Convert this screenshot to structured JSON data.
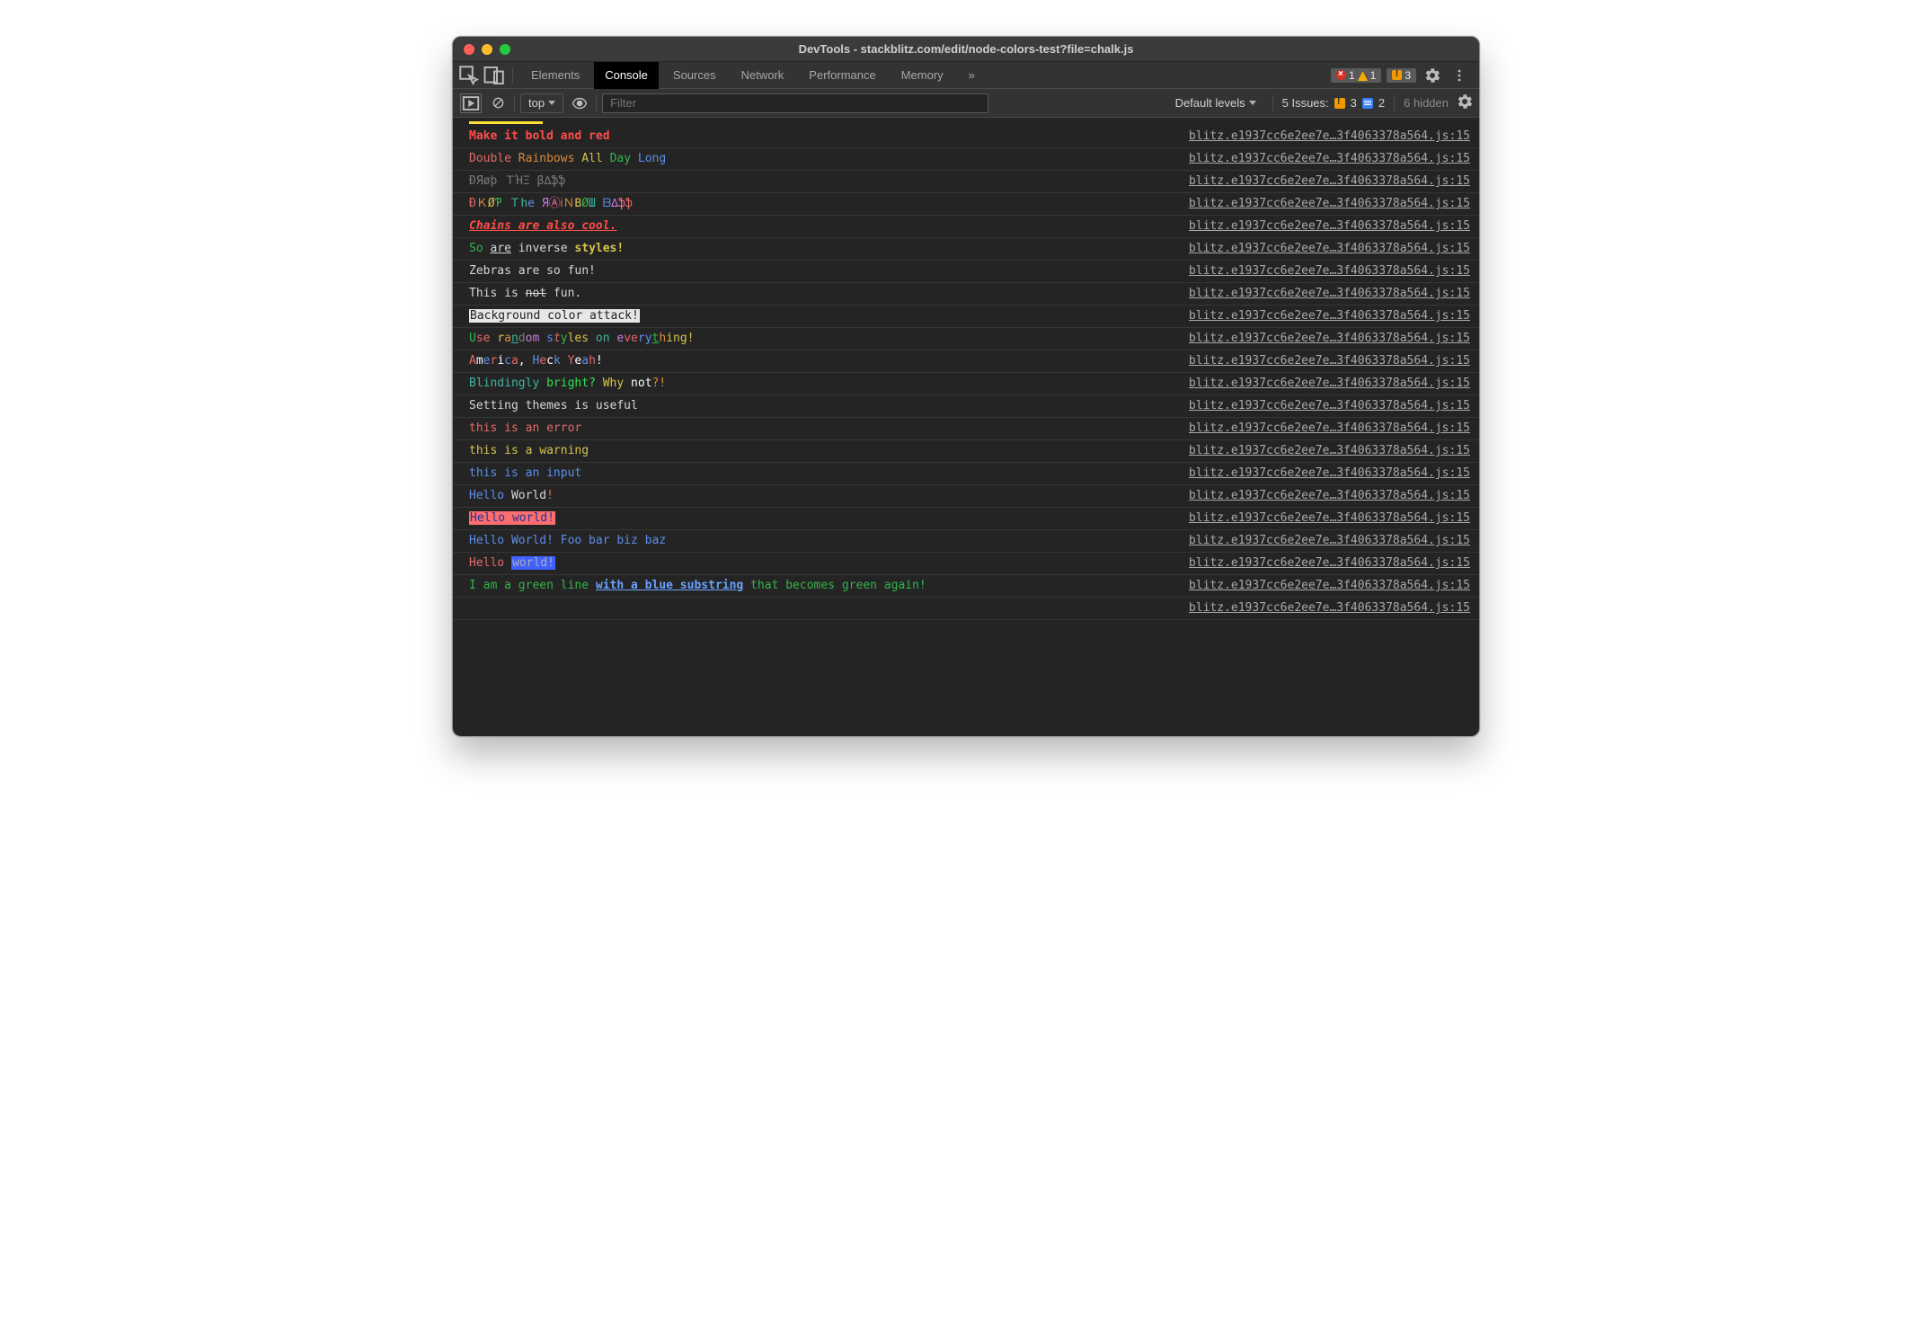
{
  "window": {
    "title": "DevTools - stackblitz.com/edit/node-colors-test?file=chalk.js"
  },
  "tabs": {
    "items": [
      "Elements",
      "Console",
      "Sources",
      "Network",
      "Performance",
      "Memory"
    ],
    "active_index": 1,
    "overflow_label": "»"
  },
  "tabbar_badges": {
    "errors": 1,
    "warnings": 1,
    "issues": 3
  },
  "toolbar": {
    "context": "top",
    "filter_placeholder": "Filter",
    "levels_label": "Default levels",
    "issues_label": "5 Issues:",
    "issue_warn_count": 3,
    "issue_chat_count": 2,
    "hidden_label": "6 hidden"
  },
  "source_link": "blitz.e1937cc6e2ee7e…3f4063378a564.js:15",
  "rows": [
    {
      "id": "bold-red",
      "html": "<span class='bold c-red-br'>Make it bold and red</span>"
    },
    {
      "id": "double-rainbows",
      "html": "<span class='c-red'>Double</span> <span class='c-orange'>Rainbows</span> <span class='c-yellow'>All</span> <span class='c-green'>Day</span> <span class='c-blue'>Long</span>"
    },
    {
      "id": "drop-bass-1",
      "html": "<span class='c-grey'>ÐЯøþ ＴΉΞ β∆ֆֆ</span>"
    },
    {
      "id": "drop-bass-2",
      "html": "<span class='c-red'>Ð</span><span class='c-orange'>Ｋ</span><span class='c-yellow'>Ø</span><span class='c-green'>Ƥ</span> <span class='c-cyan'>Ｔh</span><span class='c-blue'>e</span> <span class='c-mag'>Я</span><span class='c-pink'>Ⓐ</span><span class='c-red'>Ꭵ</span><span class='c-orange'>Ｎ</span><span class='c-yellow'>Β</span><span class='c-green'>Ø</span><span class='c-cyan'>Ш</span> <span class='c-blue'>ᗷ</span><span class='c-mag'>∆</span><span class='c-pink'>ֆ</span><span class='c-red'>ֆ</span>"
    },
    {
      "id": "chains-cool",
      "html": "<span class='bold ital under c-red-br'>Chains are also cool.</span>"
    },
    {
      "id": "inverse-styles",
      "html": "<span class='c-green'>So</span> <span class='under'>are</span> inverse <span class='bold c-yellow'>styles!</span>"
    },
    {
      "id": "zebras",
      "html": "Zebras are so fun!"
    },
    {
      "id": "not-fun",
      "html": "This is <span class='strike'>not</span> fun."
    },
    {
      "id": "bg-attack",
      "html": "<span class='bg-white'>Background color attack!</span>"
    },
    {
      "id": "random-styles",
      "html": "<span class='c-green'>U</span><span class='c-red'>se</span> <span class='c-yellow'>r</span><span class='c-orange'>a</span><span class='under c-cyan'>n</span><span class='c-grey'>d</span><span class='c-mag'>om</span> <span class='c-blue'>s</span><span class='ital c-red'>t</span><span class='c-green'>y</span><span class='c-yellow'>les</span> <span class='c-cyan'>on</span> <span class='c-mag'>e</span><span class='c-red'>ve</span><span class='c-blue'>ry</span><span class='under c-green'>t</span><span class='c-orange'>h</span><span class='c-yellow'>ing!</span>"
    },
    {
      "id": "america",
      "html": "<span class='c-red'>A</span><span class='c-white'>m</span><span class='c-blue'>e</span><span class='c-red'>r</span><span class='c-white'>i</span><span class='c-blue'>c</span><span class='c-red'>a</span><span class='c-white'>,</span> <span class='c-blue'>H</span><span class='c-red'>e</span><span class='c-white'>c</span><span class='c-blue'>k</span> <span class='c-red'>Y</span><span class='c-white'>e</span><span class='c-blue'>a</span><span class='c-red'>h</span><span class='c-white'>!</span>"
    },
    {
      "id": "blinding",
      "html": "<span class='c-cyan'>Blindingly</span> <span class='c-green-br'>bright?</span> <span class='c-yellow'>Why</span> <span class='c-white'>not</span><span class='c-orange'>?!</span>"
    },
    {
      "id": "themes",
      "html": "Setting themes is useful"
    },
    {
      "id": "is-error",
      "html": "<span class='c-red'>this is an error</span>"
    },
    {
      "id": "is-warning",
      "html": "<span class='c-yellow'>this is a warning</span>"
    },
    {
      "id": "is-input",
      "html": "<span class='c-blue'>this is an input</span>"
    },
    {
      "id": "hello-1",
      "html": "<span class='c-blue'>Hello</span> World<span class='c-red'>!</span>"
    },
    {
      "id": "hello-bg",
      "html": "<span class='bg-coral'>Hello world!</span>"
    },
    {
      "id": "hello-foo",
      "html": "<span class='c-blue'>Hello World! Foo bar biz baz</span>"
    },
    {
      "id": "hello-bgblue",
      "html": "<span class='c-red'>Hello</span> <span class='bg-blue'>world!</span>"
    },
    {
      "id": "green-line",
      "html": "<span class='c-green'>I am a green line </span><span class='bold under c-blue-br'>with a blue substring</span><span class='c-green'> that becomes green again!</span>"
    },
    {
      "id": "trailing",
      "html": " "
    }
  ]
}
